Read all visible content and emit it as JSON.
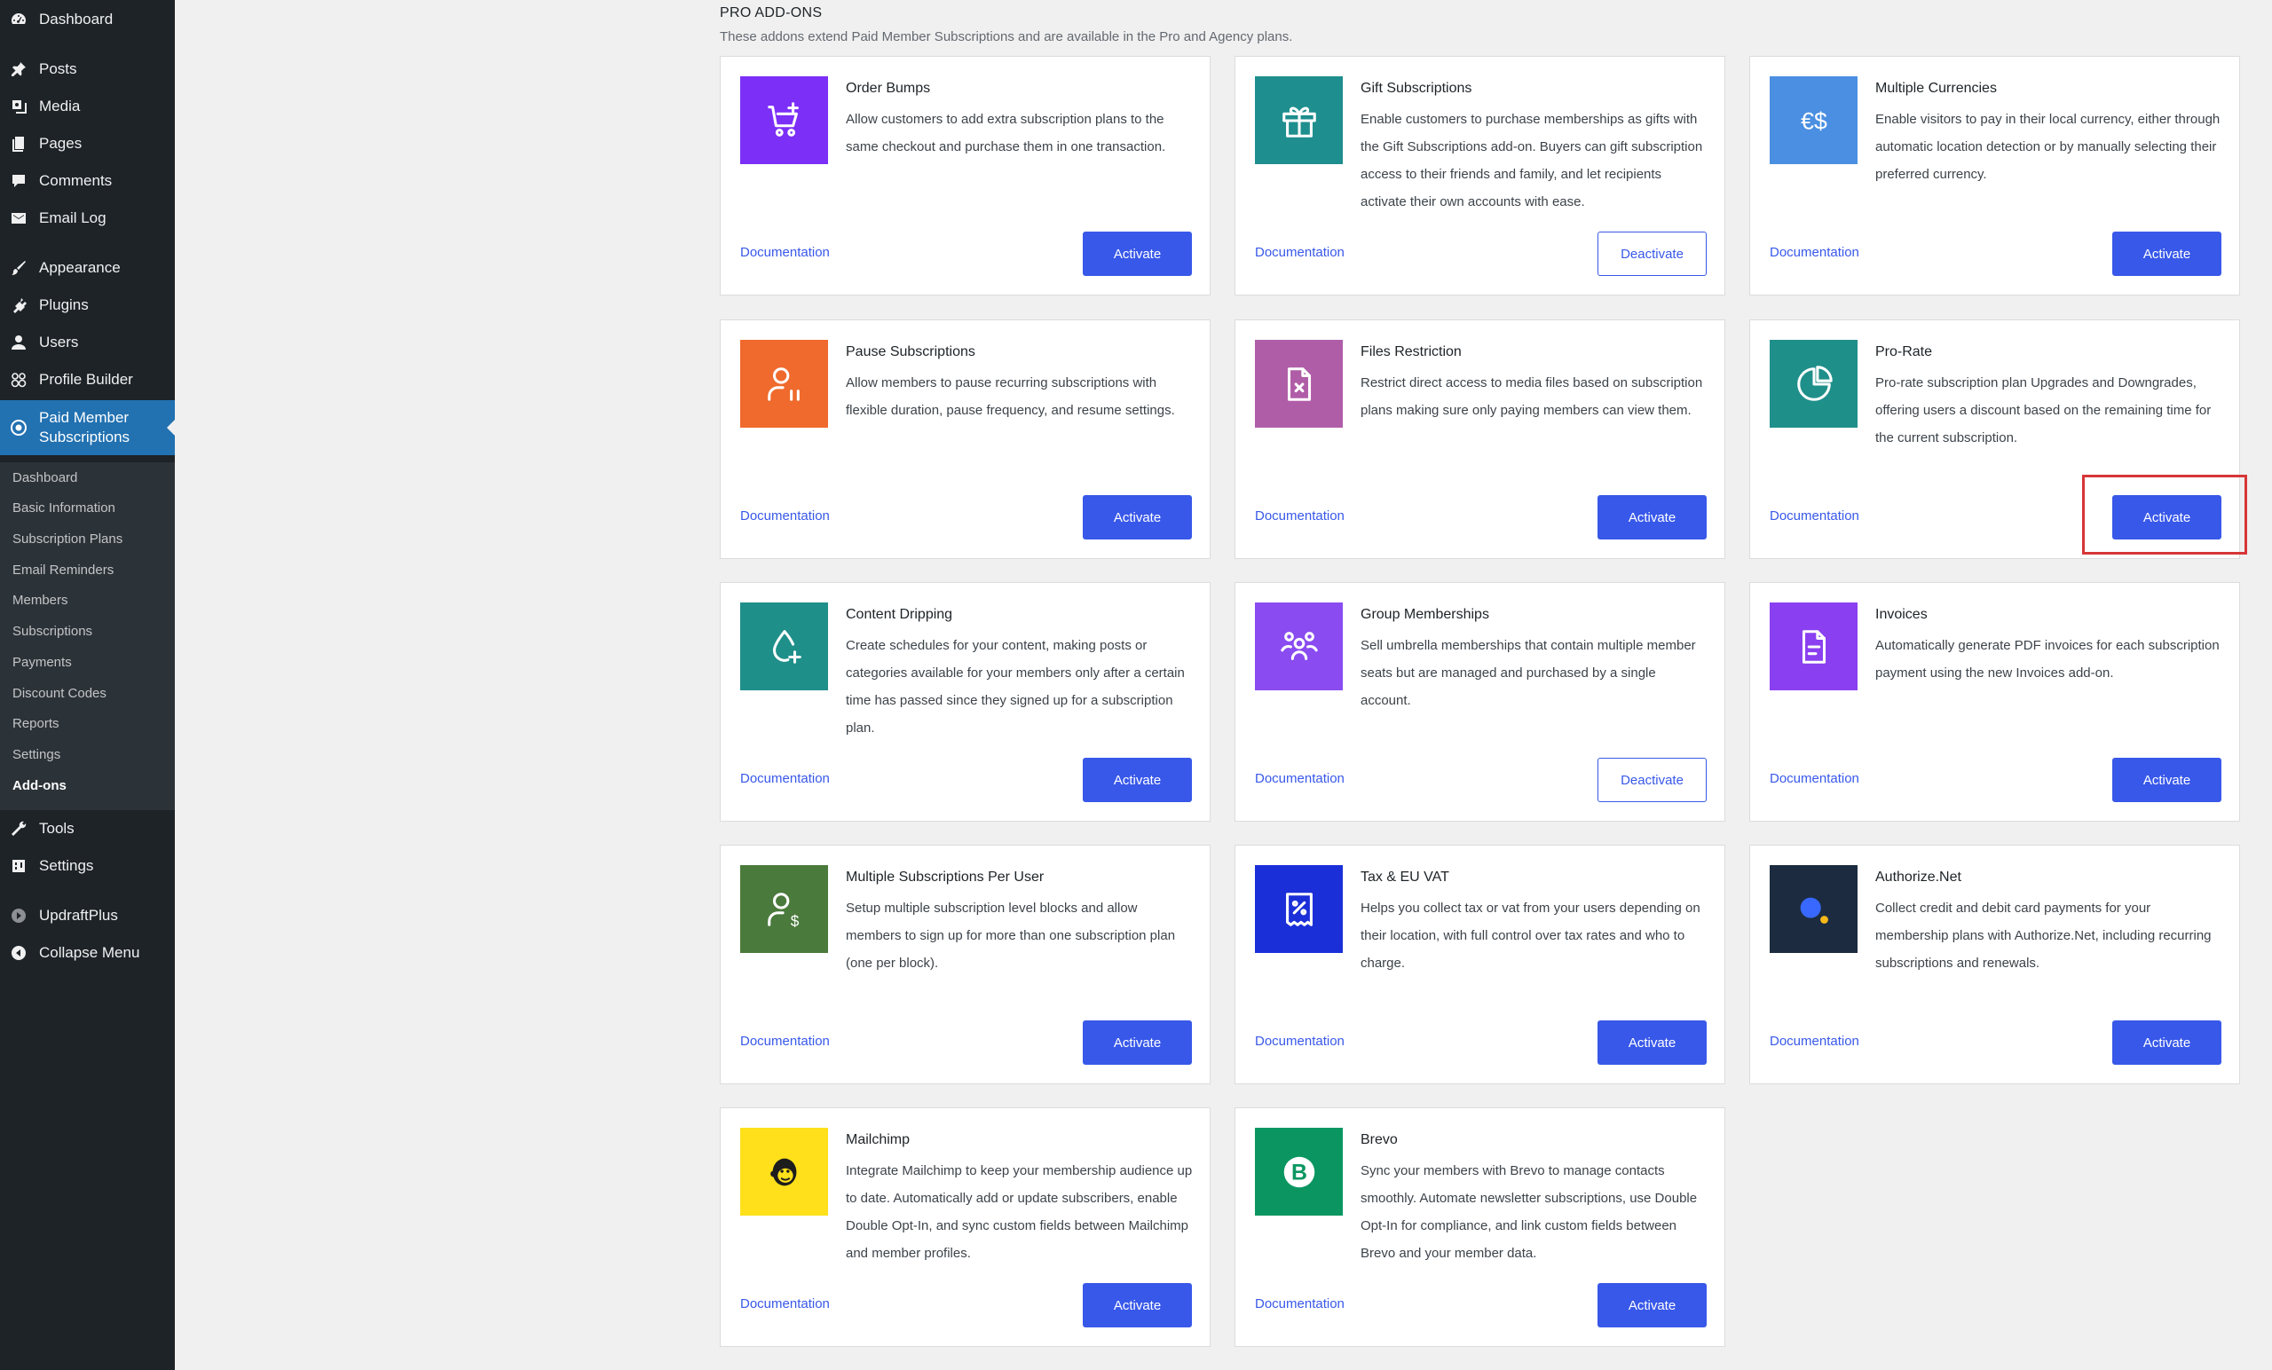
{
  "sidebar": {
    "items": [
      {
        "label": "Dashboard",
        "icon": "dashboard-icon"
      },
      {
        "label": "Posts",
        "icon": "pin-icon"
      },
      {
        "label": "Media",
        "icon": "media-icon"
      },
      {
        "label": "Pages",
        "icon": "pages-icon"
      },
      {
        "label": "Comments",
        "icon": "comment-icon"
      },
      {
        "label": "Email Log",
        "icon": "email-icon"
      },
      {
        "label": "Appearance",
        "icon": "brush-icon"
      },
      {
        "label": "Plugins",
        "icon": "plugin-icon"
      },
      {
        "label": "Users",
        "icon": "user-icon"
      },
      {
        "label": "Profile Builder",
        "icon": "profile-builder-icon"
      },
      {
        "label": "Paid Member Subscriptions",
        "icon": "pms-icon"
      },
      {
        "label": "Tools",
        "icon": "wrench-icon"
      },
      {
        "label": "Settings",
        "icon": "settings-icon"
      },
      {
        "label": "UpdraftPlus",
        "icon": "updraft-icon"
      },
      {
        "label": "Collapse Menu",
        "icon": "collapse-icon"
      }
    ],
    "submenu": [
      "Dashboard",
      "Basic Information",
      "Subscription Plans",
      "Email Reminders",
      "Members",
      "Subscriptions",
      "Payments",
      "Discount Codes",
      "Reports",
      "Settings",
      "Add-ons"
    ],
    "active_submenu": "Add-ons"
  },
  "section": {
    "title": "PRO ADD-ONS",
    "description": "These addons extend Paid Member Subscriptions and are available in the Pro and Agency plans."
  },
  "addons": [
    {
      "title": "Order Bumps",
      "description": "Allow customers to add extra subscription plans to the same checkout and purchase them in one transaction.",
      "doc_label": "Documentation",
      "button": "Activate",
      "state": "inactive",
      "icon": "cart-plus-icon",
      "color": "#7b2ff7"
    },
    {
      "title": "Gift Subscriptions",
      "description": "Enable customers to purchase memberships as gifts with the Gift Subscriptions add-on. Buyers can gift subscription access to their friends and family, and let recipients activate their own accounts with ease.",
      "doc_label": "Documentation",
      "button": "Deactivate",
      "state": "active",
      "icon": "gift-icon",
      "color": "#1e8e8e"
    },
    {
      "title": "Multiple Currencies",
      "description": "Enable visitors to pay in their local currency, either through automatic location detection or by manually selecting their preferred currency.",
      "doc_label": "Documentation",
      "button": "Activate",
      "state": "inactive",
      "icon": "currency-icon",
      "color": "#4a8fe2"
    },
    {
      "title": "Pause Subscriptions",
      "description": "Allow members to pause recurring subscriptions with flexible duration, pause frequency, and resume settings.",
      "doc_label": "Documentation",
      "button": "Activate",
      "state": "inactive",
      "icon": "user-pause-icon",
      "color": "#ef6a2c"
    },
    {
      "title": "Files Restriction",
      "description": "Restrict direct access to media files based on subscription plans making sure only paying members can view them.",
      "doc_label": "Documentation",
      "button": "Activate",
      "state": "inactive",
      "icon": "file-x-icon",
      "color": "#b05da8"
    },
    {
      "title": "Pro-Rate",
      "description": "Pro-rate subscription plan Upgrades and Downgrades, offering users a discount based on the remaining time for the current subscription.",
      "doc_label": "Documentation",
      "button": "Activate",
      "state": "inactive",
      "icon": "pie-chart-icon",
      "color": "#1f8f8a"
    },
    {
      "title": "Content Dripping",
      "description": "Create schedules for your content, making posts or categories available for your members only after a certain time has passed since they signed up for a subscription plan.",
      "doc_label": "Documentation",
      "button": "Activate",
      "state": "inactive",
      "icon": "drop-plus-icon",
      "color": "#1f8f8a"
    },
    {
      "title": "Group Memberships",
      "description": "Sell umbrella memberships that contain multiple member seats but are managed and purchased by a single account.",
      "doc_label": "Documentation",
      "button": "Deactivate",
      "state": "active",
      "icon": "group-icon",
      "color": "#8a4bf0"
    },
    {
      "title": "Invoices",
      "description": "Automatically generate PDF invoices for each subscription payment using the new Invoices add-on.",
      "doc_label": "Documentation",
      "button": "Activate",
      "state": "inactive",
      "icon": "invoice-icon",
      "color": "#8a3ff0"
    },
    {
      "title": "Multiple Subscriptions Per User",
      "description": "Setup multiple subscription level blocks and allow members to sign up for more than one subscription plan (one per block).",
      "doc_label": "Documentation",
      "button": "Activate",
      "state": "inactive",
      "icon": "user-dollar-icon",
      "color": "#4a7a3c"
    },
    {
      "title": "Tax & EU VAT",
      "description": "Helps you collect tax or vat from your users depending on their location, with full control over tax rates and who to charge.",
      "doc_label": "Documentation",
      "button": "Activate",
      "state": "inactive",
      "icon": "receipt-percent-icon",
      "color": "#1b2fd8"
    },
    {
      "title": "Authorize.Net",
      "description": "Collect credit and debit card payments for your membership plans with Authorize.Net, including recurring subscriptions and renewals.",
      "doc_label": "Documentation",
      "button": "Activate",
      "state": "inactive",
      "icon": "authorize-net-icon",
      "color": "#1c2b3f"
    },
    {
      "title": "Mailchimp",
      "description": "Integrate Mailchimp to keep your membership audience up to date. Automatically add or update subscribers, enable Double Opt-In, and sync custom fields between Mailchimp and member profiles.",
      "doc_label": "Documentation",
      "button": "Activate",
      "state": "inactive",
      "icon": "mailchimp-icon",
      "color": "#ffe01b"
    },
    {
      "title": "Brevo",
      "description": "Sync your members with Brevo to manage contacts smoothly. Automate newsletter subscriptions, use Double Opt-In for compliance, and link custom fields between Brevo and your member data.",
      "doc_label": "Documentation",
      "button": "Activate",
      "state": "inactive",
      "icon": "brevo-icon",
      "color": "#0b9661"
    }
  ],
  "colors": {
    "accent": "#3858e9",
    "sidebar_bg": "#1d2327",
    "sidebar_active": "#2271b1",
    "highlight": "#d63638"
  }
}
